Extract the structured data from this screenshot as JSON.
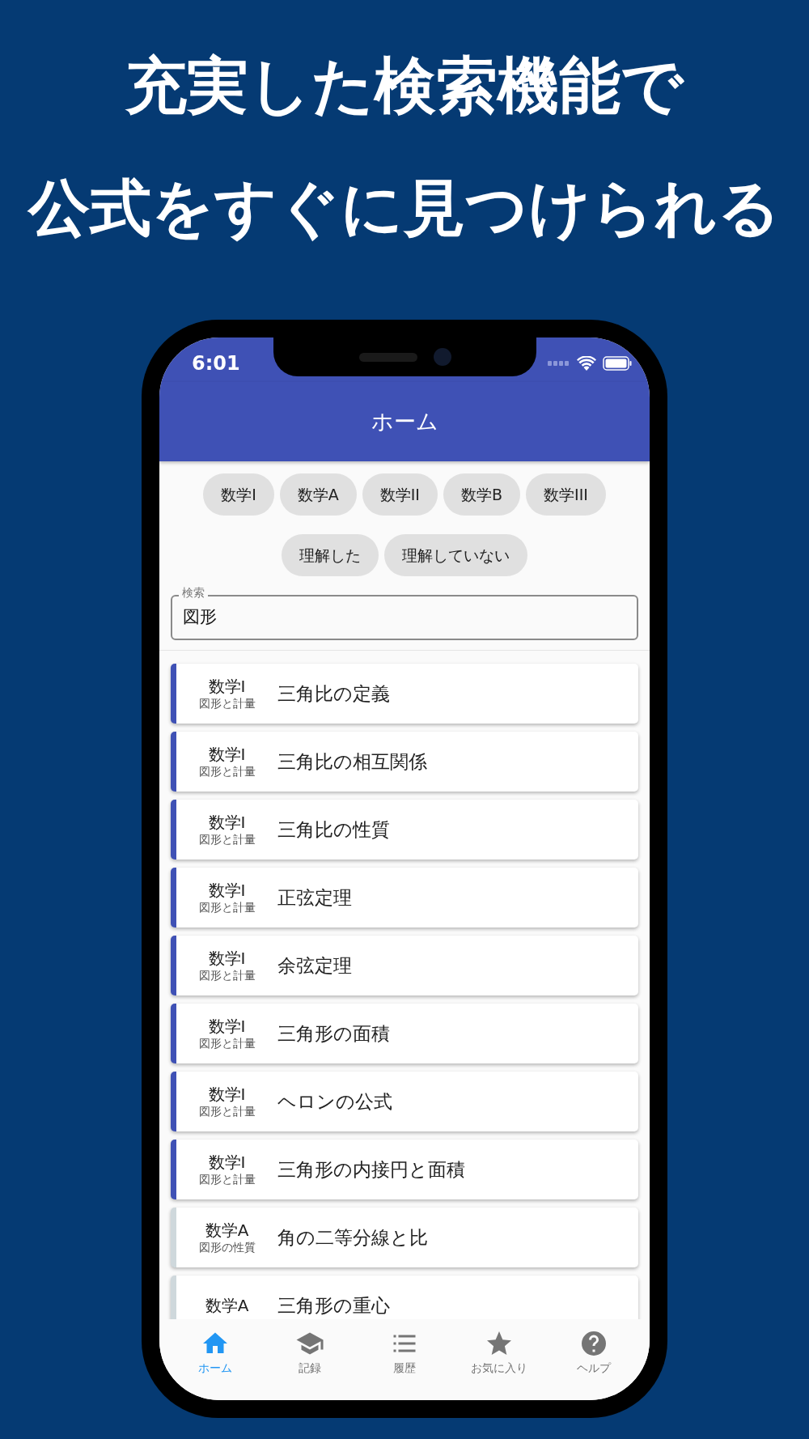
{
  "headline": [
    "充実した検索機能で",
    "公式をすぐに見つけられる"
  ],
  "status_bar": {
    "time": "6:01"
  },
  "app_bar": {
    "title": "ホーム"
  },
  "subject_filters": [
    {
      "label": "数学I",
      "selected": false
    },
    {
      "label": "数学A",
      "selected": false
    },
    {
      "label": "数学II",
      "selected": false
    },
    {
      "label": "数学B",
      "selected": false
    },
    {
      "label": "数学III",
      "selected": false
    }
  ],
  "understanding_filters": [
    {
      "label": "理解した",
      "selected": false
    },
    {
      "label": "理解していない",
      "selected": false
    }
  ],
  "search": {
    "label": "検索",
    "value": "図形"
  },
  "formulas": [
    {
      "subject": "数学I",
      "unit": "図形と計量",
      "title": "三角比の定義",
      "color": "#3f51b5"
    },
    {
      "subject": "数学I",
      "unit": "図形と計量",
      "title": "三角比の相互関係",
      "color": "#3f51b5"
    },
    {
      "subject": "数学I",
      "unit": "図形と計量",
      "title": "三角比の性質",
      "color": "#3f51b5"
    },
    {
      "subject": "数学I",
      "unit": "図形と計量",
      "title": "正弦定理",
      "color": "#3f51b5"
    },
    {
      "subject": "数学I",
      "unit": "図形と計量",
      "title": "余弦定理",
      "color": "#3f51b5"
    },
    {
      "subject": "数学I",
      "unit": "図形と計量",
      "title": "三角形の面積",
      "color": "#3f51b5"
    },
    {
      "subject": "数学I",
      "unit": "図形と計量",
      "title": "ヘロンの公式",
      "color": "#3f51b5"
    },
    {
      "subject": "数学I",
      "unit": "図形と計量",
      "title": "三角形の内接円と面積",
      "color": "#3f51b5"
    },
    {
      "subject": "数学A",
      "unit": "図形の性質",
      "title": "角の二等分線と比",
      "color": "#cfd8dc"
    },
    {
      "subject": "数学A",
      "title": "三角形の重心",
      "color": "#cfd8dc"
    }
  ],
  "tab_bar": [
    {
      "label": "ホーム",
      "selected": true
    },
    {
      "label": "記録",
      "selected": false
    },
    {
      "label": "履歴",
      "selected": false
    },
    {
      "label": "お気に入り",
      "selected": false
    },
    {
      "label": "ヘルプ",
      "selected": false
    }
  ]
}
